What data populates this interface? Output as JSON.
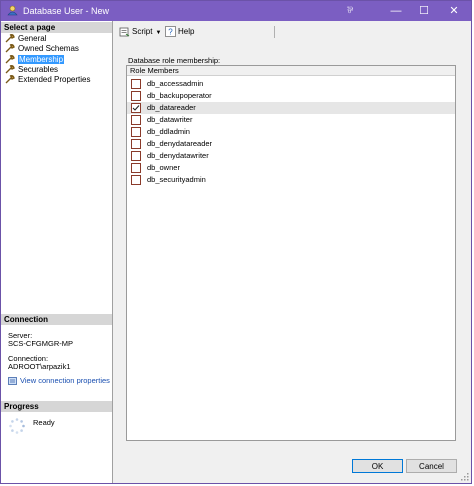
{
  "window": {
    "title": "Database User - New",
    "title_glyph": "⅌",
    "controls": {
      "minimize": "—",
      "maximize": "☐",
      "close": "✕"
    }
  },
  "left_panel": {
    "select_page_header": "Select a page",
    "pages": [
      {
        "label": "General",
        "selected": false
      },
      {
        "label": "Owned Schemas",
        "selected": false
      },
      {
        "label": "Membership",
        "selected": true
      },
      {
        "label": "Securables",
        "selected": false
      },
      {
        "label": "Extended Properties",
        "selected": false
      }
    ],
    "connection": {
      "header": "Connection",
      "server_label": "Server:",
      "server_value": "SCS-CFGMGR-MP",
      "connection_label": "Connection:",
      "connection_value": "ADROOT\\arpazik1",
      "view_link": "View connection properties"
    },
    "progress": {
      "header": "Progress",
      "status": "Ready"
    }
  },
  "toolbar": {
    "script_label": "Script",
    "help_label": "Help"
  },
  "main": {
    "group_label": "Database role membership:",
    "column_header": "Role Members",
    "roles": [
      {
        "name": "db_accessadmin",
        "checked": false
      },
      {
        "name": "db_backupoperator",
        "checked": false
      },
      {
        "name": "db_datareader",
        "checked": true
      },
      {
        "name": "db_datawriter",
        "checked": false
      },
      {
        "name": "db_ddladmin",
        "checked": false
      },
      {
        "name": "db_denydatareader",
        "checked": false
      },
      {
        "name": "db_denydatawriter",
        "checked": false
      },
      {
        "name": "db_owner",
        "checked": false
      },
      {
        "name": "db_securityadmin",
        "checked": false
      }
    ]
  },
  "buttons": {
    "ok": "OK",
    "cancel": "Cancel"
  },
  "colors": {
    "titlebar": "#7b5ec2",
    "selection": "#3399ff",
    "link": "#1a4fb0"
  }
}
